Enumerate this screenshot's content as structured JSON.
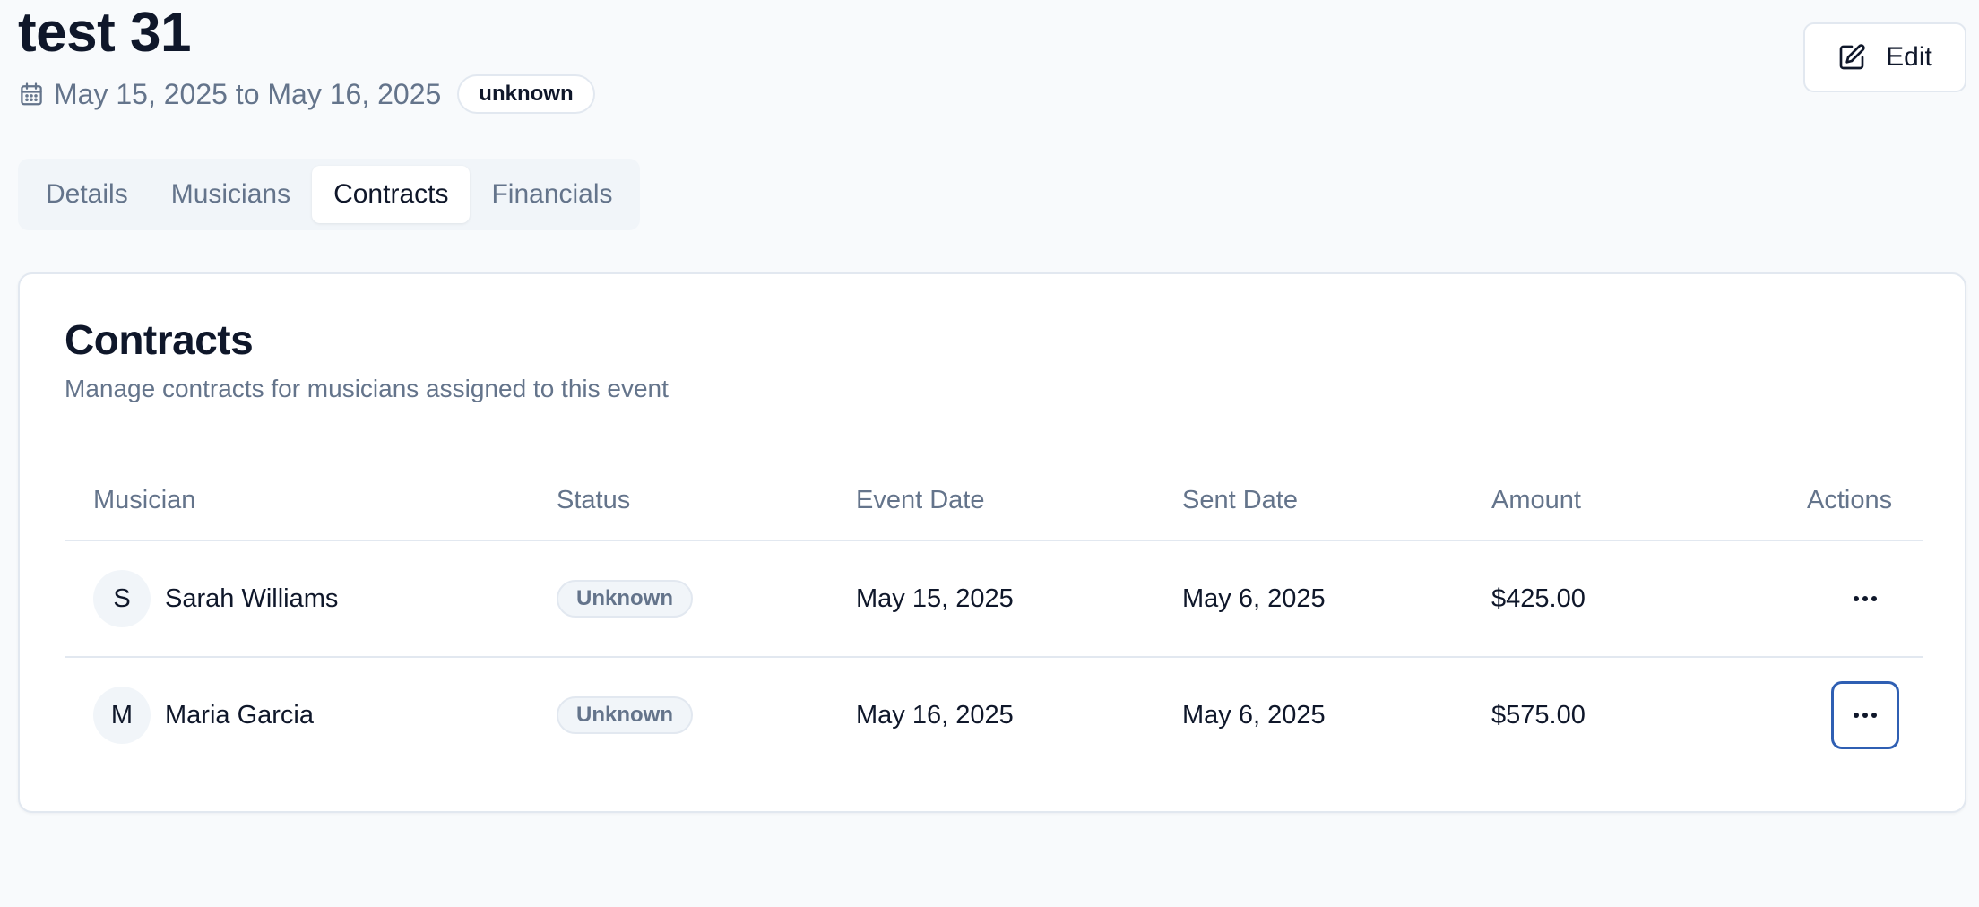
{
  "event": {
    "title": "test 31",
    "date_range": "May 15, 2025 to May 16, 2025",
    "status": "unknown"
  },
  "header": {
    "edit_label": "Edit"
  },
  "tabs": [
    {
      "label": "Details",
      "active": false
    },
    {
      "label": "Musicians",
      "active": false
    },
    {
      "label": "Contracts",
      "active": true
    },
    {
      "label": "Financials",
      "active": false
    }
  ],
  "contracts": {
    "title": "Contracts",
    "subtitle": "Manage contracts for musicians assigned to this event",
    "columns": {
      "musician": "Musician",
      "status": "Status",
      "event_date": "Event Date",
      "sent_date": "Sent Date",
      "amount": "Amount",
      "actions": "Actions"
    },
    "rows": [
      {
        "initial": "S",
        "name": "Sarah Williams",
        "status": "Unknown",
        "event_date": "May 15, 2025",
        "sent_date": "May 6, 2025",
        "amount": "$425.00"
      },
      {
        "initial": "M",
        "name": "Maria Garcia",
        "status": "Unknown",
        "event_date": "May 16, 2025",
        "sent_date": "May 6, 2025",
        "amount": "$575.00"
      }
    ]
  },
  "icons": {
    "calendar": "calendar-icon",
    "edit": "edit-icon",
    "more": "more-horizontal-icon"
  },
  "colors": {
    "focus_ring": "#2f5fb3",
    "muted_text": "#64748b",
    "primary_text": "#0f172a"
  }
}
